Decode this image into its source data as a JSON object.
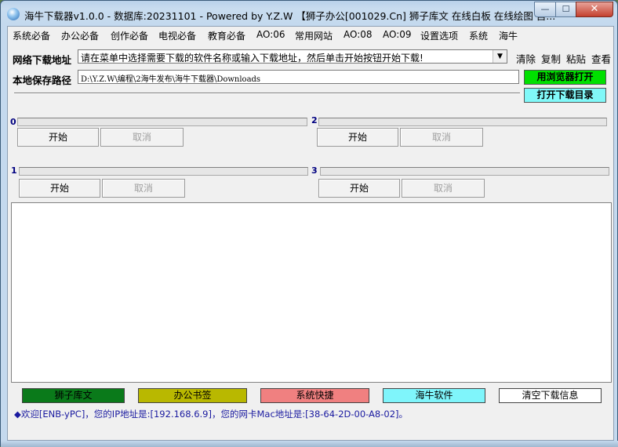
{
  "window": {
    "title": "海牛下载器v1.0.0 - 数据库:20231101 - Powered by Y.Z.W   【狮子办公[001029.Cn] 狮子库文 在线白板 在线绘图 自...",
    "min_label": "—",
    "max_label": "☐",
    "close_label": "✕"
  },
  "menu": [
    "系统必备",
    "办公必备",
    "创作必备",
    "电视必备",
    "教育必备",
    "AO:06",
    "常用网站",
    "AO:08",
    "AO:09",
    "设置选项",
    "系统",
    "海牛"
  ],
  "download": {
    "url_label": "网络下载地址",
    "url_value": "请在菜单中选择需要下载的软件名称或输入下载地址，然后单击开始按钮开始下载!",
    "clear": "清除",
    "copy": "复制",
    "paste": "粘贴",
    "view": "查看",
    "path_label": "本地保存路径",
    "path_value": "D:\\Y.Z.W\\编程\\2海牛发布\\海牛下载器\\Downloads",
    "browser_open": "用浏览器打开",
    "open_dir": "打开下载目录"
  },
  "slots": [
    {
      "num": "0",
      "start": "开始",
      "cancel": "取消",
      "progress": 0
    },
    {
      "num": "1",
      "start": "开始",
      "cancel": "取消",
      "progress": 0
    },
    {
      "num": "2",
      "start": "开始",
      "cancel": "取消",
      "progress": 0
    },
    {
      "num": "3",
      "start": "开始",
      "cancel": "取消",
      "progress": 0
    }
  ],
  "bottom_buttons": {
    "b1": "狮子库文",
    "b2": "办公书签",
    "b3": "系统快捷",
    "b4": "海牛软件",
    "b5": "清空下载信息"
  },
  "colors": {
    "b1": "#0a7a1a",
    "b2": "#b9b800",
    "b3": "#f08080",
    "b4": "#7ff5fb",
    "b5": "#ffffff",
    "browser_open": "#00e000",
    "open_dir": "#80f8f8"
  },
  "status": {
    "diamond": "◆",
    "text": "欢迎[ENB-yPC]，您的IP地址是:[192.168.6.9]，您的网卡Mac地址是:[38-64-2D-00-A8-02]。"
  }
}
